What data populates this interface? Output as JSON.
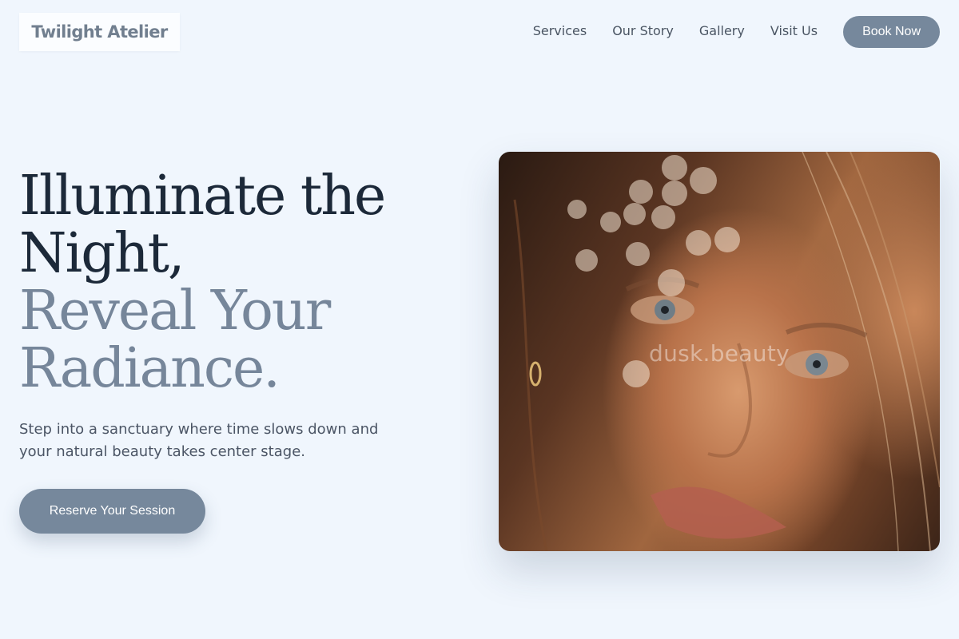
{
  "brand": {
    "name": "Twilight Atelier"
  },
  "nav": {
    "links": [
      "Services",
      "Our Story",
      "Gallery",
      "Visit Us"
    ],
    "cta_label": "Book Now"
  },
  "hero": {
    "heading_lines": [
      "Illuminate the",
      "Night,",
      "Reveal Your",
      "Radiance."
    ],
    "subtitle": "Step into a sanctuary where time slows down and your natural beauty takes center stage.",
    "cta_label": "Reserve Your Session",
    "image": {
      "watermark": "dusk.beauty",
      "subject": "close-up portrait of a woman with freckles and bokeh light"
    }
  },
  "colors": {
    "background": "#f0f6fd",
    "accent": "#76889c",
    "heading_dark": "#1c2939",
    "heading_muted": "#76869a",
    "logo": "#717f8f"
  }
}
